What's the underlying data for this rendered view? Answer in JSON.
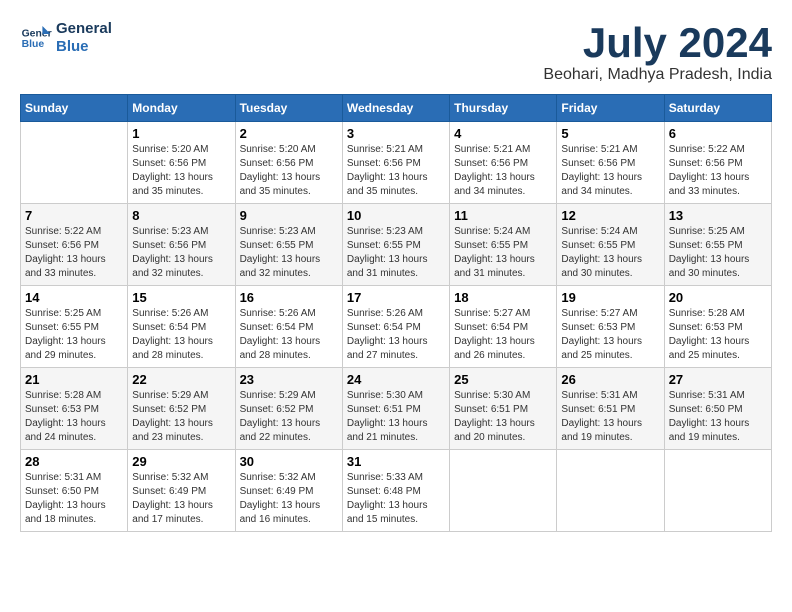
{
  "header": {
    "logo_line1": "General",
    "logo_line2": "Blue",
    "month_year": "July 2024",
    "location": "Beohari, Madhya Pradesh, India"
  },
  "days_of_week": [
    "Sunday",
    "Monday",
    "Tuesday",
    "Wednesday",
    "Thursday",
    "Friday",
    "Saturday"
  ],
  "weeks": [
    [
      {
        "day": "",
        "info": ""
      },
      {
        "day": "1",
        "info": "Sunrise: 5:20 AM\nSunset: 6:56 PM\nDaylight: 13 hours\nand 35 minutes."
      },
      {
        "day": "2",
        "info": "Sunrise: 5:20 AM\nSunset: 6:56 PM\nDaylight: 13 hours\nand 35 minutes."
      },
      {
        "day": "3",
        "info": "Sunrise: 5:21 AM\nSunset: 6:56 PM\nDaylight: 13 hours\nand 35 minutes."
      },
      {
        "day": "4",
        "info": "Sunrise: 5:21 AM\nSunset: 6:56 PM\nDaylight: 13 hours\nand 34 minutes."
      },
      {
        "day": "5",
        "info": "Sunrise: 5:21 AM\nSunset: 6:56 PM\nDaylight: 13 hours\nand 34 minutes."
      },
      {
        "day": "6",
        "info": "Sunrise: 5:22 AM\nSunset: 6:56 PM\nDaylight: 13 hours\nand 33 minutes."
      }
    ],
    [
      {
        "day": "7",
        "info": "Sunrise: 5:22 AM\nSunset: 6:56 PM\nDaylight: 13 hours\nand 33 minutes."
      },
      {
        "day": "8",
        "info": "Sunrise: 5:23 AM\nSunset: 6:56 PM\nDaylight: 13 hours\nand 32 minutes."
      },
      {
        "day": "9",
        "info": "Sunrise: 5:23 AM\nSunset: 6:55 PM\nDaylight: 13 hours\nand 32 minutes."
      },
      {
        "day": "10",
        "info": "Sunrise: 5:23 AM\nSunset: 6:55 PM\nDaylight: 13 hours\nand 31 minutes."
      },
      {
        "day": "11",
        "info": "Sunrise: 5:24 AM\nSunset: 6:55 PM\nDaylight: 13 hours\nand 31 minutes."
      },
      {
        "day": "12",
        "info": "Sunrise: 5:24 AM\nSunset: 6:55 PM\nDaylight: 13 hours\nand 30 minutes."
      },
      {
        "day": "13",
        "info": "Sunrise: 5:25 AM\nSunset: 6:55 PM\nDaylight: 13 hours\nand 30 minutes."
      }
    ],
    [
      {
        "day": "14",
        "info": "Sunrise: 5:25 AM\nSunset: 6:55 PM\nDaylight: 13 hours\nand 29 minutes."
      },
      {
        "day": "15",
        "info": "Sunrise: 5:26 AM\nSunset: 6:54 PM\nDaylight: 13 hours\nand 28 minutes."
      },
      {
        "day": "16",
        "info": "Sunrise: 5:26 AM\nSunset: 6:54 PM\nDaylight: 13 hours\nand 28 minutes."
      },
      {
        "day": "17",
        "info": "Sunrise: 5:26 AM\nSunset: 6:54 PM\nDaylight: 13 hours\nand 27 minutes."
      },
      {
        "day": "18",
        "info": "Sunrise: 5:27 AM\nSunset: 6:54 PM\nDaylight: 13 hours\nand 26 minutes."
      },
      {
        "day": "19",
        "info": "Sunrise: 5:27 AM\nSunset: 6:53 PM\nDaylight: 13 hours\nand 25 minutes."
      },
      {
        "day": "20",
        "info": "Sunrise: 5:28 AM\nSunset: 6:53 PM\nDaylight: 13 hours\nand 25 minutes."
      }
    ],
    [
      {
        "day": "21",
        "info": "Sunrise: 5:28 AM\nSunset: 6:53 PM\nDaylight: 13 hours\nand 24 minutes."
      },
      {
        "day": "22",
        "info": "Sunrise: 5:29 AM\nSunset: 6:52 PM\nDaylight: 13 hours\nand 23 minutes."
      },
      {
        "day": "23",
        "info": "Sunrise: 5:29 AM\nSunset: 6:52 PM\nDaylight: 13 hours\nand 22 minutes."
      },
      {
        "day": "24",
        "info": "Sunrise: 5:30 AM\nSunset: 6:51 PM\nDaylight: 13 hours\nand 21 minutes."
      },
      {
        "day": "25",
        "info": "Sunrise: 5:30 AM\nSunset: 6:51 PM\nDaylight: 13 hours\nand 20 minutes."
      },
      {
        "day": "26",
        "info": "Sunrise: 5:31 AM\nSunset: 6:51 PM\nDaylight: 13 hours\nand 19 minutes."
      },
      {
        "day": "27",
        "info": "Sunrise: 5:31 AM\nSunset: 6:50 PM\nDaylight: 13 hours\nand 19 minutes."
      }
    ],
    [
      {
        "day": "28",
        "info": "Sunrise: 5:31 AM\nSunset: 6:50 PM\nDaylight: 13 hours\nand 18 minutes."
      },
      {
        "day": "29",
        "info": "Sunrise: 5:32 AM\nSunset: 6:49 PM\nDaylight: 13 hours\nand 17 minutes."
      },
      {
        "day": "30",
        "info": "Sunrise: 5:32 AM\nSunset: 6:49 PM\nDaylight: 13 hours\nand 16 minutes."
      },
      {
        "day": "31",
        "info": "Sunrise: 5:33 AM\nSunset: 6:48 PM\nDaylight: 13 hours\nand 15 minutes."
      },
      {
        "day": "",
        "info": ""
      },
      {
        "day": "",
        "info": ""
      },
      {
        "day": "",
        "info": ""
      }
    ]
  ]
}
